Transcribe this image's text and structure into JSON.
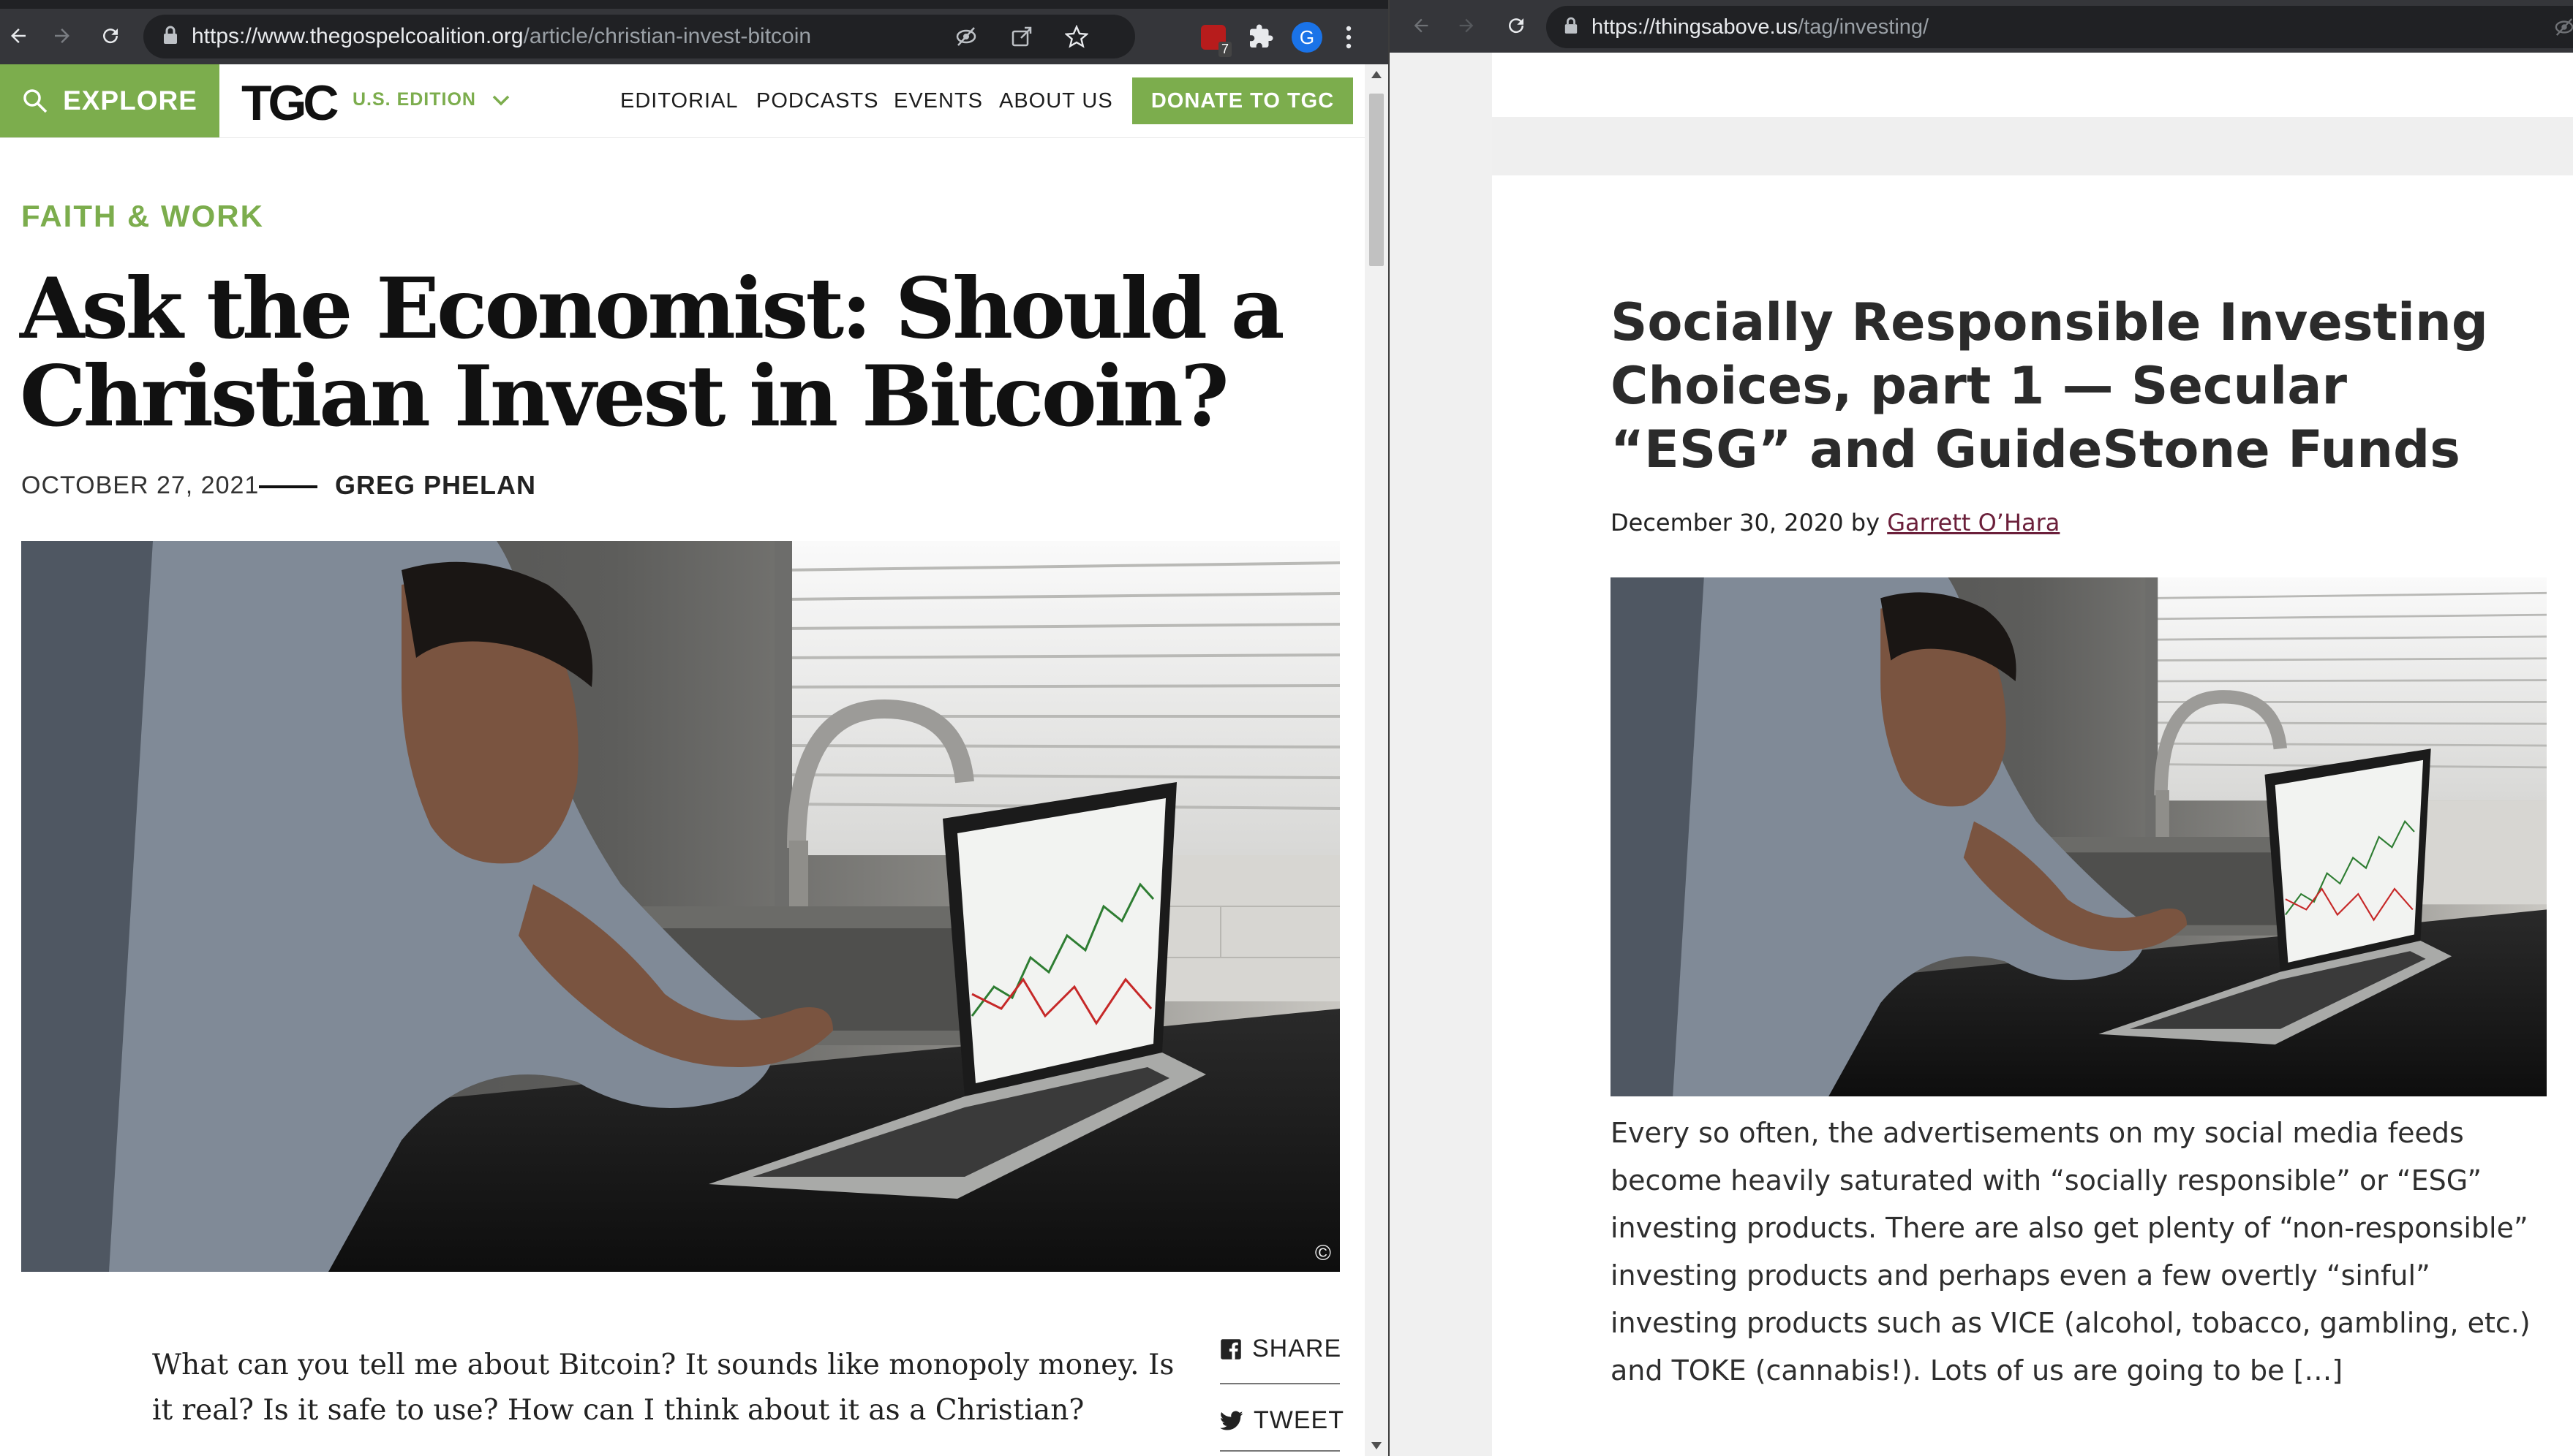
{
  "left_window": {
    "url_domain": "https://www.thegospelcoalition.org",
    "url_path": "/article/christian-invest-bitcoin",
    "extension_badge": "7",
    "profile_initial": "G",
    "header": {
      "explore_label": "EXPLORE",
      "logo_text": "TGC",
      "edition_label": "U.S. EDITION",
      "nav_items": [
        "EDITORIAL",
        "PODCASTS",
        "EVENTS",
        "ABOUT US"
      ],
      "donate_label": "DONATE TO TGC"
    },
    "article": {
      "category": "FAITH & WORK",
      "title": "Ask the Economist: Should a Christian Invest in Bitcoin?",
      "date": "OCTOBER 27, 2021",
      "author": "GREG PHELAN",
      "photo_credit": "©",
      "lede": "What can you tell me about Bitcoin? It sounds like monopoly money. Is it real? Is it safe to use? How can I think about it as a Christian?",
      "share_label": "SHARE",
      "tweet_label": "TWEET"
    }
  },
  "right_window": {
    "url_domain": "https://thingsabove.us",
    "url_path": "/tag/investing/",
    "post": {
      "title": "Socially Responsible Investing Choices, part 1 — Secular “ESG” and GuideStone Funds",
      "date": "December 30, 2020",
      "by_label": "by",
      "author": "Garrett O’Hara",
      "excerpt": "Every so often, the advertisements on my social media feeds become heavily saturated with “socially responsible” or “ESG” investing products. There are also get plenty of “non-responsible” investing products and perhaps even a few overtly “sinful” investing products such as VICE (alcohol, tobacco, gambling, etc.) and TOKE (cannabis!). Lots of us are going to be […]"
    }
  },
  "colors": {
    "tgc_green": "#7cad4d",
    "chrome_dark": "#35363a",
    "omnibox": "#202124",
    "author_link": "#6b1f3a"
  }
}
